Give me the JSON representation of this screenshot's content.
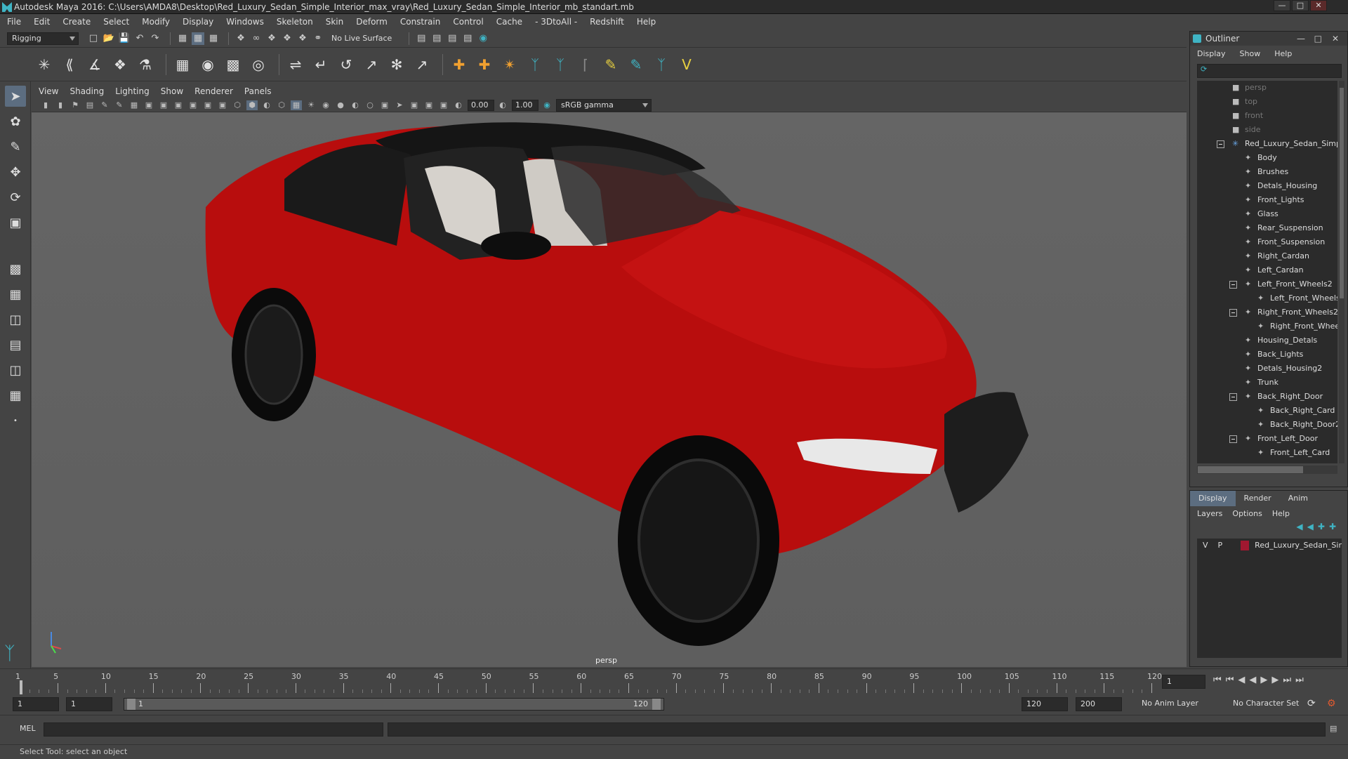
{
  "window": {
    "title": "Autodesk Maya 2016: C:\\Users\\AMDA8\\Desktop\\Red_Luxury_Sedan_Simple_Interior_max_vray\\Red_Luxury_Sedan_Simple_Interior_mb_standart.mb",
    "min": "—",
    "max": "□",
    "close": "✕"
  },
  "menubar": [
    "File",
    "Edit",
    "Create",
    "Select",
    "Modify",
    "Display",
    "Windows",
    "Skeleton",
    "Skin",
    "Deform",
    "Constrain",
    "Control",
    "Cache",
    "- 3DtoAll -",
    "Redshift",
    "Help"
  ],
  "statusline": {
    "mode": "Rigging",
    "live_surface": "No Live Surface"
  },
  "panel": {
    "menus": [
      "View",
      "Shading",
      "Lighting",
      "Show",
      "Renderer",
      "Panels"
    ],
    "near": "0.00",
    "far": "1.00",
    "colorspace": "sRGB gamma",
    "camera_label": "persp"
  },
  "outliner": {
    "title": "Outliner",
    "menus": [
      "Display",
      "Show",
      "Help"
    ],
    "items": [
      {
        "label": "persp",
        "depth": 0,
        "dim": true,
        "icon": "camera"
      },
      {
        "label": "top",
        "depth": 0,
        "dim": true,
        "icon": "camera"
      },
      {
        "label": "front",
        "depth": 0,
        "dim": true,
        "icon": "camera"
      },
      {
        "label": "side",
        "depth": 0,
        "dim": true,
        "icon": "camera"
      },
      {
        "label": "Red_Luxury_Sedan_Simple",
        "depth": 0,
        "expand": true,
        "icon": "star"
      },
      {
        "label": "Body",
        "depth": 1,
        "icon": "mesh"
      },
      {
        "label": "Brushes",
        "depth": 1,
        "icon": "mesh"
      },
      {
        "label": "Detals_Housing",
        "depth": 1,
        "icon": "mesh"
      },
      {
        "label": "Front_Lights",
        "depth": 1,
        "icon": "mesh"
      },
      {
        "label": "Glass",
        "depth": 1,
        "icon": "mesh"
      },
      {
        "label": "Rear_Suspension",
        "depth": 1,
        "icon": "mesh"
      },
      {
        "label": "Front_Suspension",
        "depth": 1,
        "icon": "mesh"
      },
      {
        "label": "Right_Cardan",
        "depth": 1,
        "icon": "mesh"
      },
      {
        "label": "Left_Cardan",
        "depth": 1,
        "icon": "mesh"
      },
      {
        "label": "Left_Front_Wheels2",
        "depth": 1,
        "expand": true,
        "icon": "mesh"
      },
      {
        "label": "Left_Front_Wheels",
        "depth": 2,
        "icon": "mesh"
      },
      {
        "label": "Right_Front_Wheels2",
        "depth": 1,
        "expand": true,
        "icon": "mesh"
      },
      {
        "label": "Right_Front_Whee",
        "depth": 2,
        "icon": "mesh"
      },
      {
        "label": "Housing_Detals",
        "depth": 1,
        "icon": "mesh"
      },
      {
        "label": "Back_Lights",
        "depth": 1,
        "icon": "mesh"
      },
      {
        "label": "Detals_Housing2",
        "depth": 1,
        "icon": "mesh"
      },
      {
        "label": "Trunk",
        "depth": 1,
        "icon": "mesh"
      },
      {
        "label": "Back_Right_Door",
        "depth": 1,
        "expand": true,
        "icon": "mesh"
      },
      {
        "label": "Back_Right_Card",
        "depth": 2,
        "icon": "mesh"
      },
      {
        "label": "Back_Right_Door2",
        "depth": 2,
        "icon": "mesh"
      },
      {
        "label": "Front_Left_Door",
        "depth": 1,
        "expand": true,
        "icon": "mesh"
      },
      {
        "label": "Front_Left_Card",
        "depth": 2,
        "icon": "mesh"
      }
    ]
  },
  "layers": {
    "tabs": [
      "Display",
      "Render",
      "Anim"
    ],
    "menus": [
      "Layers",
      "Options",
      "Help"
    ],
    "rows": [
      {
        "v": "V",
        "p": "P",
        "name": "Red_Luxury_Sedan_Sir",
        "color": "#a01830"
      }
    ]
  },
  "timeline": {
    "ticks": [
      1,
      5,
      10,
      15,
      20,
      25,
      30,
      35,
      40,
      45,
      50,
      55,
      60,
      65,
      70,
      75,
      80,
      85,
      90,
      95,
      100,
      105,
      110,
      115,
      120
    ],
    "start": 1,
    "end": 120,
    "current": "1"
  },
  "range": {
    "start_time": "1",
    "playback_start": "1",
    "slider_start": "1",
    "slider_end": "120",
    "playback_end": "120",
    "end_time": "200",
    "anim_layer": "No Anim Layer",
    "char_set": "No Character Set"
  },
  "cmd": {
    "lang": "MEL"
  },
  "help": "Select Tool: select an object",
  "colors": {
    "car_red": "#c00c0c",
    "accent": "#5c6d80",
    "maya_teal": "#3fb4c4"
  }
}
